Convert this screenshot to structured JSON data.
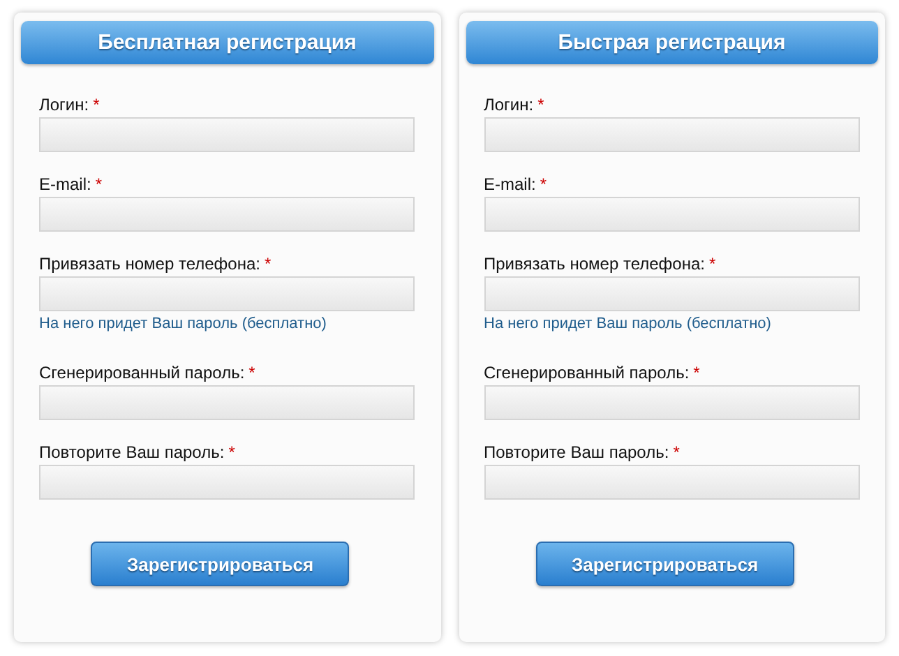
{
  "panels": [
    {
      "title": "Бесплатная регистрация",
      "fields": [
        {
          "label": "Логин:",
          "required_mark": "*"
        },
        {
          "label": "E-mail:",
          "required_mark": "*"
        },
        {
          "label": "Привязать номер телефона:",
          "required_mark": "*",
          "hint": "На него придет Ваш пароль (бесплатно)"
        },
        {
          "label": "Сгенерированный пароль:",
          "required_mark": "*"
        },
        {
          "label": "Повторите Ваш пароль:",
          "required_mark": "*"
        }
      ],
      "button": "Зарегистрироваться"
    },
    {
      "title": "Быстрая регистрация",
      "fields": [
        {
          "label": "Логин:",
          "required_mark": "*"
        },
        {
          "label": "E-mail:",
          "required_mark": "*"
        },
        {
          "label": "Привязать номер телефона:",
          "required_mark": "*",
          "hint": "На него придет Ваш пароль (бесплатно)"
        },
        {
          "label": "Сгенерированный пароль:",
          "required_mark": "*"
        },
        {
          "label": "Повторите Ваш пароль:",
          "required_mark": "*"
        }
      ],
      "button": "Зарегистрироваться"
    }
  ]
}
